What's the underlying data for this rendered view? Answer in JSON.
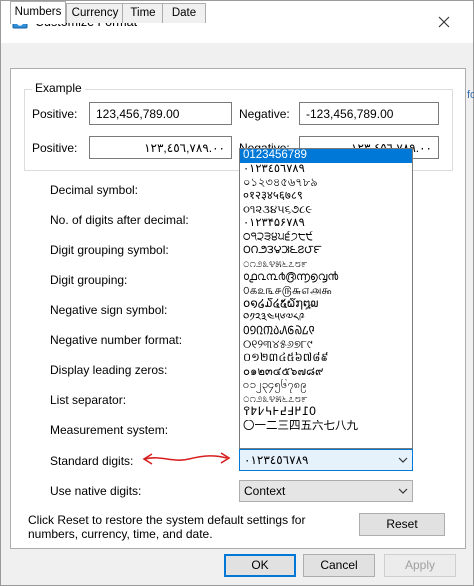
{
  "window": {
    "title": "Customize Format",
    "icon": "customize-format-icon"
  },
  "tabs": [
    "Numbers",
    "Currency",
    "Time",
    "Date"
  ],
  "example": {
    "title": "Example",
    "row1": {
      "pos_label": "Positive:",
      "pos_value": "123,456,789.00",
      "neg_label": "Negative:",
      "neg_value": "-123,456,789.00"
    },
    "row2": {
      "pos_label": "Positive:",
      "pos_value": "١٢٣,٤٥٦,٧٨٩.٠٠",
      "neg_label": "Negative:",
      "neg_value": "-١٢٣,٤٥٦,٧٨٩.٠٠"
    }
  },
  "labels": {
    "decimal_symbol": "Decimal symbol:",
    "digits_after_decimal": "No. of digits after decimal:",
    "digit_grouping_symbol": "Digit grouping symbol:",
    "digit_grouping": "Digit grouping:",
    "negative_sign_symbol": "Negative sign symbol:",
    "negative_number_format": "Negative number format:",
    "display_leading_zeros": "Display leading zeros:",
    "list_separator": "List separator:",
    "measurement_system": "Measurement system:",
    "standard_digits": "Standard digits:",
    "use_native_digits": "Use native digits:"
  },
  "standard_digits": {
    "selected": "٠١٢٣٤٥٦٧٨٩",
    "options": [
      "0123456789",
      "٠١٢٣٤٥٦٧٨٩",
      "০১২৩৪৫৬৭৮৯",
      "०१२३४५६७८९",
      "૦૧૨૩૪૫૬૭૮૯",
      "۰۱۲۳۴۵۶۷۸۹",
      "੦੧੨੩੪੫੬੭੮੯",
      "౦౧౨౩౪౫౬౭౮౯",
      "೦೧೨೩೪೫೬೭೮೯",
      "൦൧൨൩൪൫൬൭൮൯",
      "௦௧௨௩௪௫௬௭௮௯",
      "໐໑໒໓໔໕໖໗໘໙",
      "༠༡༢༣༤༥༦༧༨༩",
      "᠐᠑᠒᠓᠔᠕᠖᠗᠘᠙",
      "୦୧୨୩୪୫୬୭୮୯",
      "០១២៣៤៥៦៧៨៩",
      "๐๑๒๓๔๕๖๗๘๙",
      "၀၁၂၃၄၅၆၇၈၉",
      "೦೧೨೩೪೫೬೭೮೯",
      "߀߁߂߃߄߅߆߇߈߉",
      "〇一二三四五六七八九"
    ],
    "highlighted_index": 0
  },
  "use_native_digits": {
    "value": "Context"
  },
  "info_text": "Click Reset to restore the system default settings for numbers, currency, time, and date.",
  "buttons": {
    "reset": "Reset",
    "ok": "OK",
    "cancel": "Cancel",
    "apply": "Apply"
  },
  "background_fragment": "fo"
}
